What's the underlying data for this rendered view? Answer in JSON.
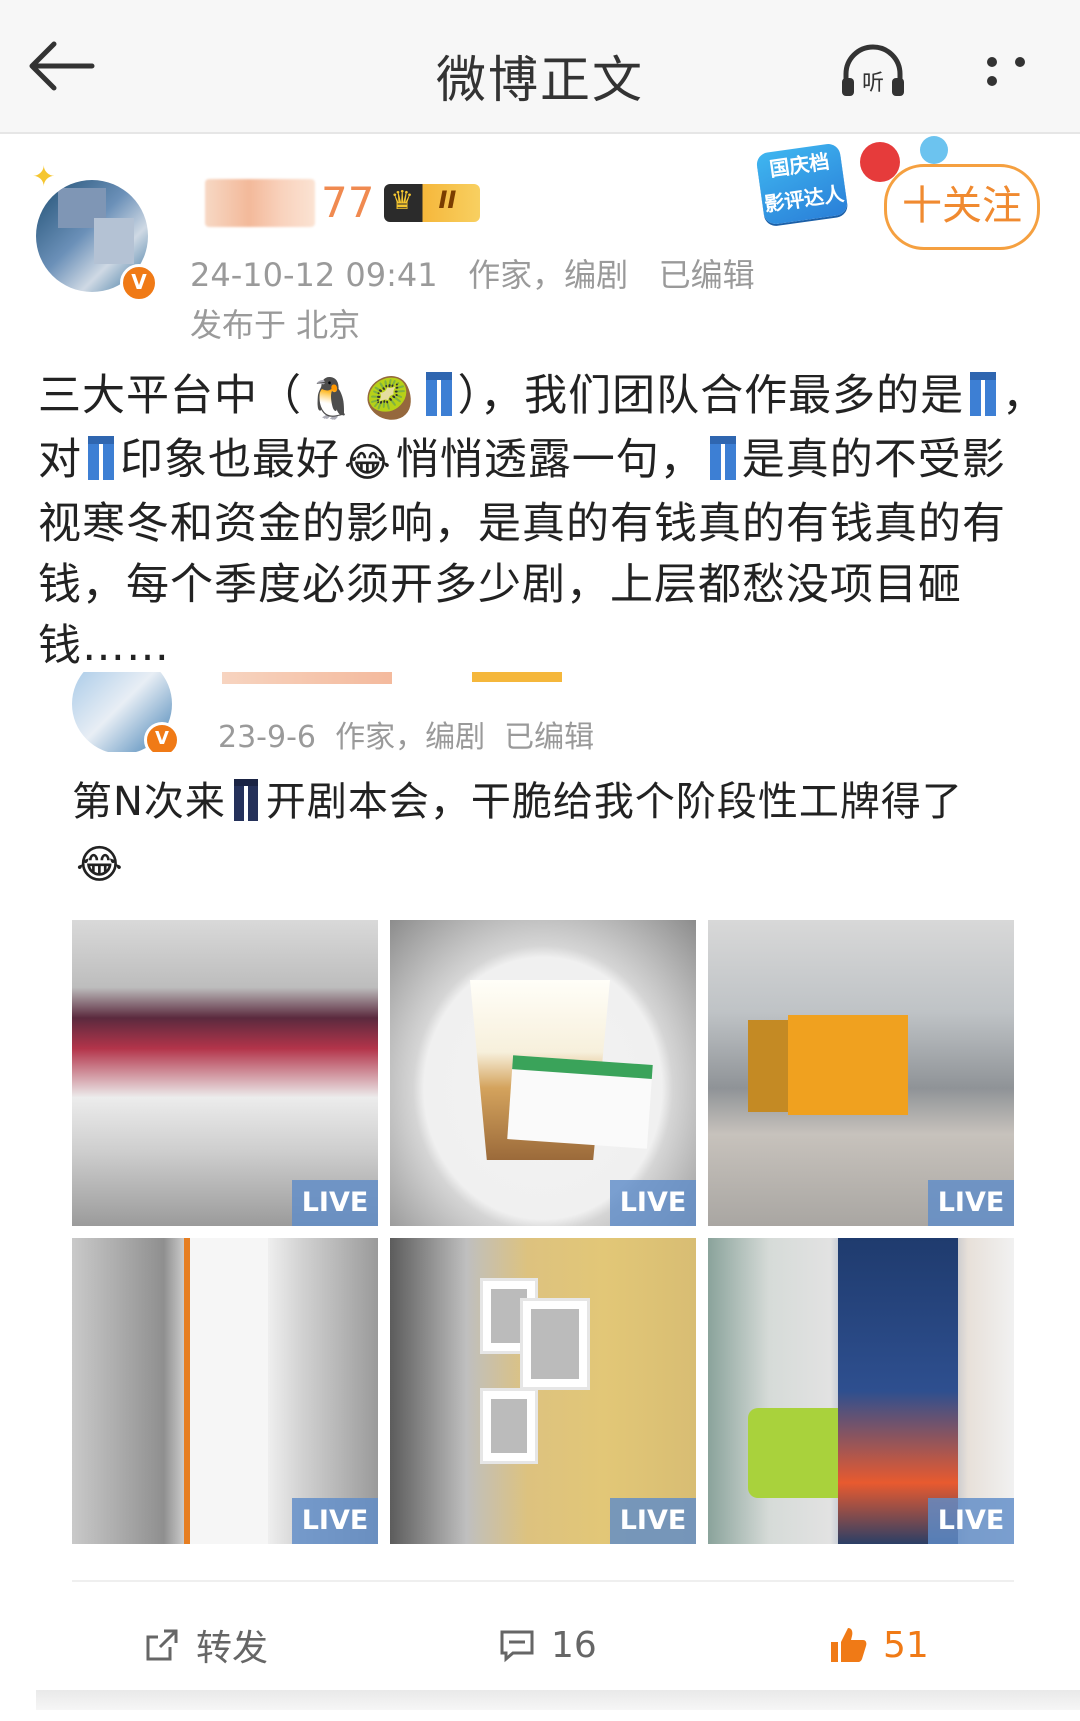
{
  "topbar": {
    "title": "微博正文",
    "listen_label": "听",
    "back_icon": "arrow-left-icon",
    "more_icon": "more-dots-icon"
  },
  "author": {
    "name_suffix": "77",
    "level": "II",
    "verified_mark": "V",
    "meta": "24-10-12 09:41   作家，编剧   已编辑",
    "location": "发布于 北京",
    "holiday_tag": "国庆档 影评达人"
  },
  "follow": {
    "label": "十关注"
  },
  "post": {
    "segments": [
      {
        "t": "三大平台中（"
      },
      {
        "emoji": "🐧"
      },
      {
        "emoji": "🥝"
      },
      {
        "jeans": true
      },
      {
        "t": "），我们团队合作最多的是"
      },
      {
        "jeans": true
      },
      {
        "t": "，对"
      },
      {
        "jeans": true
      },
      {
        "t": "印象也最好"
      },
      {
        "emoji": "😂"
      },
      {
        "t": "悄悄透露一句，"
      },
      {
        "jeans": true
      },
      {
        "t": "是真的不受影视寒冬和资金的影响，是真的有钱真的有钱真的有钱，每个季度必须开多少剧，上层都愁没项目砸钱……"
      }
    ]
  },
  "quote": {
    "meta": "23-9-6  作家，编剧  已编辑",
    "text_part1": "第N次来",
    "text_part2": "开剧本会，干脆给我个阶段性工牌得了",
    "emoji": "😂",
    "verified_mark": "V"
  },
  "photos": [
    {
      "live": "LIVE"
    },
    {
      "live": "LIVE"
    },
    {
      "live": "LIVE"
    },
    {
      "live": "LIVE"
    },
    {
      "live": "LIVE"
    },
    {
      "live": "LIVE"
    }
  ],
  "actions": {
    "repost_label": "转发",
    "comment_count": "16",
    "like_count": "51"
  },
  "colors": {
    "accent": "#f07a16",
    "follow_border": "#f5a040",
    "live_badge": "#5f8cc8",
    "meta_gray": "#9a9a9a"
  }
}
